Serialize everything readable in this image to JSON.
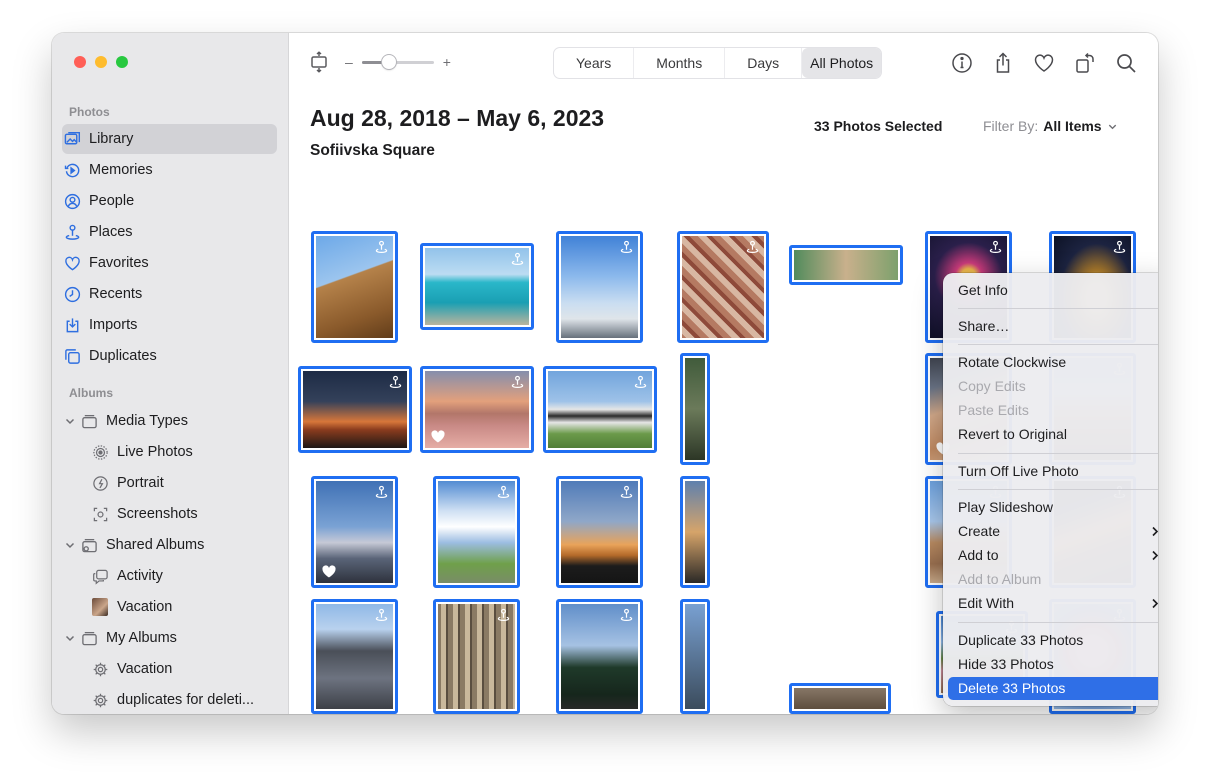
{
  "sidebar": {
    "photos_header": "Photos",
    "items": [
      {
        "label": "Library",
        "icon": "library-icon"
      },
      {
        "label": "Memories",
        "icon": "memories-icon"
      },
      {
        "label": "People",
        "icon": "people-icon"
      },
      {
        "label": "Places",
        "icon": "places-icon"
      },
      {
        "label": "Favorites",
        "icon": "heart-icon"
      },
      {
        "label": "Recents",
        "icon": "clock-icon"
      },
      {
        "label": "Imports",
        "icon": "import-icon"
      },
      {
        "label": "Duplicates",
        "icon": "duplicates-icon"
      }
    ],
    "albums_header": "Albums",
    "albums": {
      "media_types": "Media Types",
      "live_photos": "Live Photos",
      "portrait": "Portrait",
      "screenshots": "Screenshots",
      "shared_albums": "Shared Albums",
      "activity": "Activity",
      "vacation_shared": "Vacation",
      "my_albums": "My Albums",
      "vacation": "Vacation",
      "duplicates_album": "duplicates for deleti..."
    }
  },
  "toolbar": {
    "zoom_minus": "–",
    "zoom_plus": "+",
    "zoom_level": 0.35,
    "tabs": [
      "Years",
      "Months",
      "Days",
      "All Photos"
    ],
    "active_tab": "All Photos"
  },
  "header": {
    "title": "Aug 28, 2018 – May 6, 2023",
    "subtitle": "Sofiivska Square",
    "selected_count": "33 Photos Selected",
    "filter_label": "Filter By:",
    "filter_value": "All Items"
  },
  "context_menu": {
    "get_info": "Get Info",
    "share": "Share…",
    "rotate": "Rotate Clockwise",
    "copy_edits": "Copy Edits",
    "paste_edits": "Paste Edits",
    "revert": "Revert to Original",
    "turn_off_live": "Turn Off Live Photo",
    "play_slideshow": "Play Slideshow",
    "create": "Create",
    "add_to": "Add to",
    "add_to_album": "Add to Album",
    "edit_with": "Edit With",
    "duplicate": "Duplicate 33 Photos",
    "hide": "Hide 33 Photos",
    "delete": "Delete 33 Photos"
  },
  "colors": {
    "selection_blue": "#1f6ef2",
    "menu_highlight": "#2f6fe7",
    "sidebar_bg": "#e8e8ea"
  }
}
